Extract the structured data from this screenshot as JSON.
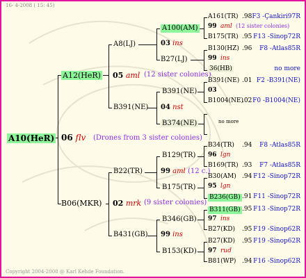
{
  "header": {
    "date": "16-  4-2008 ( 15: 45)"
  },
  "footer": {
    "copyright": "Copyright 2004-2008 @ Karl Kehde Foundation."
  },
  "tree": {
    "root": {
      "id": "A10(HeR)",
      "year": "06",
      "breeder": "flv",
      "note": "(Drones from 3 sister colonies)"
    },
    "dam": {
      "id": "A12(HeR)",
      "year": "05",
      "breeder": "aml",
      "note": "(12 sister colonies)"
    },
    "sire": {
      "id": "B06(MKR)",
      "year": "02",
      "breeder": "mrk",
      "note": "(9 sister colonies)"
    },
    "g2": [
      {
        "id": "A8(LJ)",
        "year": "03",
        "breeder": "ins"
      },
      {
        "id": "B391(NE)",
        "year": "04",
        "breeder": "nst"
      },
      {
        "id": "B22(TR)",
        "year": "99",
        "breeder": "aml",
        "note": "(12 c.)"
      },
      {
        "id": "B431(GB)",
        "year": "99",
        "breeder": "ins"
      }
    ],
    "g3": [
      "A100(AM)",
      "B27(LJ)",
      "B391(NE)",
      "B374(NE)",
      "B129(TR)",
      "B175(TR)",
      "B346(GB)",
      "B153(KD)"
    ],
    "g4": [
      {
        "type": "id",
        "id": "A161(TR)",
        "score": ".98",
        "tag": "F3 -Çankiri97R"
      },
      {
        "type": "year",
        "year": "99",
        "breeder": "aml",
        "note": "(12 sister colonies)"
      },
      {
        "type": "id",
        "id": "B175(TR)",
        "score": ".95",
        "tag": "F13 -Sinop72R"
      },
      {
        "type": "id",
        "id": "B130(HZ)",
        "score": ".96",
        "tag": "F8 -Atlas85R"
      },
      {
        "type": "year",
        "year": "99",
        "breeder": "ins"
      },
      {
        "type": "id",
        "id": "36(HB)",
        "score": ".",
        "tag": "no more",
        "pale": true
      },
      {
        "type": "id",
        "id": "B391(NE)",
        "score": ".01",
        "tag": "F2 -B391(NE)"
      },
      {
        "type": "year",
        "year": "03",
        "breeder": ""
      },
      {
        "type": "id",
        "id": "B1004(NE)",
        "score": ".02",
        "tag": "F0 -B1004(NE)"
      },
      {
        "type": "blank"
      },
      {
        "type": "nomore",
        "text": "no more"
      },
      {
        "type": "blank"
      },
      {
        "type": "id",
        "id": "B34(TR)",
        "score": ".94",
        "tag": "F8 -Atlas85R"
      },
      {
        "type": "year",
        "year": "96",
        "breeder": "lgn"
      },
      {
        "type": "id",
        "id": "B169(TR)",
        "score": ".93",
        "tag": "F7 -Atlas85R"
      },
      {
        "type": "id",
        "id": "B30(AM)",
        "score": ".94",
        "tag": "F12 -Sinop72R"
      },
      {
        "type": "year",
        "year": "95",
        "breeder": "lgn"
      },
      {
        "type": "id",
        "id": "B236(GB)",
        "score": ".91",
        "tag": "F11 -Sinop72R",
        "hl": true
      },
      {
        "type": "id",
        "id": "B311(GB)",
        "score": ".95",
        "tag": "F13 -Sinop72R",
        "hl": true
      },
      {
        "type": "year",
        "year": "97",
        "breeder": "ins"
      },
      {
        "type": "id",
        "id": "B27(KD)",
        "score": ".95",
        "tag": "F19 -Sinop62R"
      },
      {
        "type": "id",
        "id": "B27(KD)",
        "score": ".95",
        "tag": "F19 -Sinop62R"
      },
      {
        "type": "year",
        "year": "97",
        "breeder": "rud"
      },
      {
        "type": "id",
        "id": "B81(WP)",
        "score": ".94",
        "tag": "F16 -Sinop62R"
      }
    ]
  }
}
